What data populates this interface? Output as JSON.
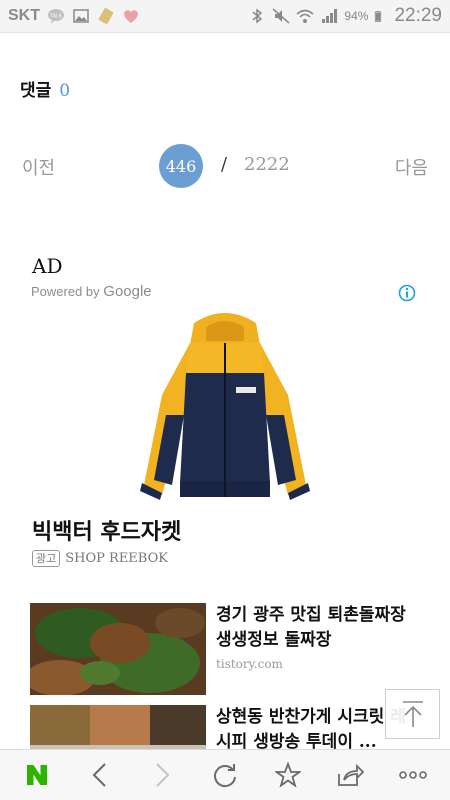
{
  "status_bar": {
    "carrier": "SKT",
    "battery": "94%",
    "time": "22:29",
    "icons": [
      "talk-icon",
      "gallery-icon",
      "note-icon",
      "heart-icon",
      "bluetooth-icon",
      "mute-icon",
      "wifi-icon",
      "signal-icon",
      "battery-icon"
    ]
  },
  "comments": {
    "label": "댓글",
    "count": "0"
  },
  "pagination": {
    "prev": "이전",
    "current": "446",
    "separator": "/",
    "total": "2222",
    "next": "다음"
  },
  "ad": {
    "label": "AD",
    "powered_by": "Powered by",
    "brand": "Google",
    "title": "빅백터 후드자켓",
    "badge": "광고",
    "source": "SHOP REEBOK",
    "image_icon": "jacket-image"
  },
  "related": [
    {
      "title": "경기 광주 맛집 퇴촌돌짜장 생생정보 돌짜장",
      "source": "tistory.com"
    },
    {
      "title": "상현동 반찬가게 시크릿 레시피 생방송 투데이 ...",
      "source": ""
    }
  ],
  "bottom_nav": [
    "naver-home",
    "back",
    "forward",
    "refresh",
    "favorite",
    "share",
    "more"
  ],
  "colors": {
    "accent": "#6b9ed2",
    "naver_green": "#2db400"
  }
}
